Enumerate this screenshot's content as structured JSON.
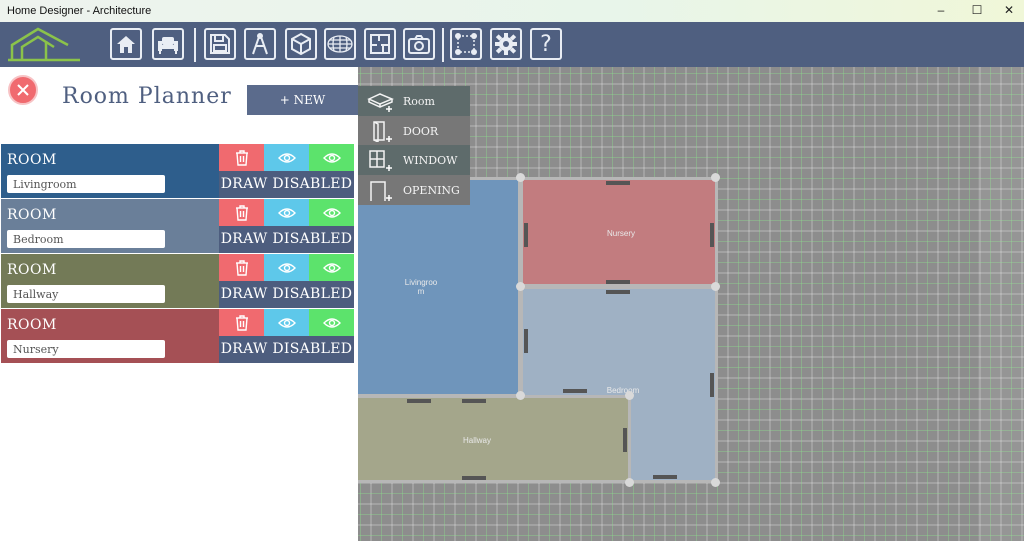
{
  "window": {
    "title": "Home Designer - Architecture",
    "controls": [
      "–",
      "☐",
      "✕"
    ]
  },
  "toolbar": {
    "icons": [
      "home-icon",
      "furniture-icon",
      "save-icon",
      "drafting-icon",
      "3d-box-icon",
      "mesh-icon",
      "floorplan-icon",
      "camera-icon",
      "select-points-icon",
      "gear-icon",
      "help-icon"
    ],
    "help_label": "?",
    "accent": "#4f5f80",
    "logo_color": "#8bc34a"
  },
  "planner": {
    "title": "Room Planner",
    "new_label": "+ NEW",
    "rooms": [
      {
        "type": "ROOM",
        "name": "Livingroom",
        "color": "#2e5e8c",
        "draw": "DRAW DISABLED"
      },
      {
        "type": "ROOM",
        "name": "Bedroom",
        "color": "#6a7f99",
        "draw": "DRAW DISABLED"
      },
      {
        "type": "ROOM",
        "name": "Hallway",
        "color": "#737a57",
        "draw": "DRAW DISABLED"
      },
      {
        "type": "ROOM",
        "name": "Nursery",
        "color": "#a55055",
        "draw": "DRAW DISABLED"
      }
    ]
  },
  "add_menu": {
    "items": [
      {
        "label": "Room",
        "icon": "room-icon"
      },
      {
        "label": "DOOR",
        "icon": "door-icon"
      },
      {
        "label": "WINDOW",
        "icon": "window-icon"
      },
      {
        "label": "OPENING",
        "icon": "opening-icon"
      }
    ]
  },
  "canvas": {
    "rooms": [
      {
        "label": "Livingroo\nm",
        "color": "#6f95bb"
      },
      {
        "label": "Nursery",
        "color": "#c27c7f"
      },
      {
        "label": "Bedroom",
        "color": "#9fb1c4"
      },
      {
        "label": "Hallway",
        "color": "#a4a68b"
      }
    ]
  }
}
